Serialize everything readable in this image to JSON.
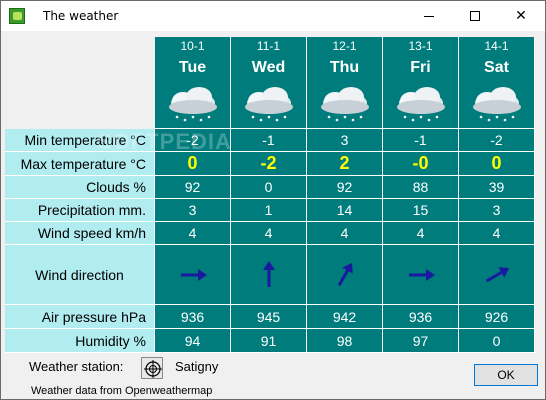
{
  "window": {
    "title": "The weather"
  },
  "days": [
    {
      "date": "10-1",
      "day": "Tue",
      "min": "-2",
      "max": "0",
      "clouds": "92",
      "precip": "3",
      "wind_speed": "4",
      "wind_dir_deg": 90,
      "pressure": "936",
      "humidity": "94"
    },
    {
      "date": "11-1",
      "day": "Wed",
      "min": "-1",
      "max": "-2",
      "clouds": "0",
      "precip": "1",
      "wind_speed": "4",
      "wind_dir_deg": 0,
      "pressure": "945",
      "humidity": "91"
    },
    {
      "date": "12-1",
      "day": "Thu",
      "min": "3",
      "max": "2",
      "clouds": "92",
      "precip": "14",
      "wind_speed": "4",
      "wind_dir_deg": 30,
      "pressure": "942",
      "humidity": "98"
    },
    {
      "date": "13-1",
      "day": "Fri",
      "min": "-1",
      "max": "-0",
      "clouds": "88",
      "precip": "15",
      "wind_speed": "4",
      "wind_dir_deg": 90,
      "pressure": "936",
      "humidity": "97"
    },
    {
      "date": "14-1",
      "day": "Sat",
      "min": "-2",
      "max": "0",
      "clouds": "39",
      "precip": "3",
      "wind_speed": "4",
      "wind_dir_deg": 60,
      "pressure": "926",
      "humidity": "0"
    }
  ],
  "labels": {
    "min": "Min temperature °C",
    "max": "Max temperature °C",
    "clouds": "Clouds  %",
    "precip": "Precipitation  mm.",
    "wind_speed": "Wind speed km/h",
    "wind_dir": "Wind direction",
    "pressure": "Air pressure hPa",
    "humidity": "Humidity %"
  },
  "footer": {
    "station_label": "Weather station:",
    "station_name": "Satigny",
    "source": "Weather data from Openweathermap",
    "ok_label": "OK"
  },
  "watermark": "SOFTPEDIA",
  "colors": {
    "header_bg": "#007c7c",
    "label_bg": "#b0ecf0",
    "max_temp": "#ffff00",
    "arrow": "#1a1aa0"
  }
}
